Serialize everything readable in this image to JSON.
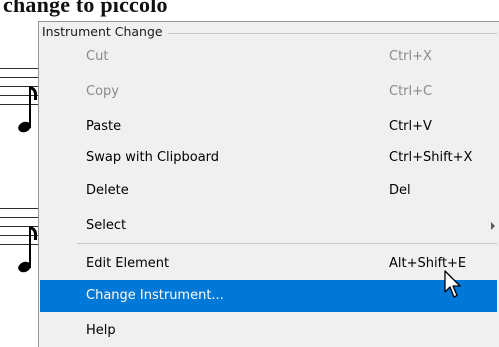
{
  "score": {
    "text": "change to piccolo"
  },
  "menu": {
    "title": "Instrument Change",
    "items": [
      {
        "label": "Cut",
        "shortcut": "Ctrl+X",
        "enabled": false
      },
      {
        "label": "Copy",
        "shortcut": "Ctrl+C",
        "enabled": false
      },
      {
        "label": "Paste",
        "shortcut": "Ctrl+V",
        "enabled": true
      },
      {
        "label": "Swap with Clipboard",
        "shortcut": "Ctrl+Shift+X",
        "enabled": true
      },
      {
        "label": "Delete",
        "shortcut": "Del",
        "enabled": true
      },
      {
        "label": "Select",
        "shortcut": "",
        "enabled": true,
        "has_submenu": true
      },
      {
        "label": "Edit Element",
        "shortcut": "Alt+Shift+E",
        "enabled": true
      },
      {
        "label": "Change Instrument...",
        "shortcut": "",
        "enabled": true,
        "highlighted": true
      },
      {
        "label": "Help",
        "shortcut": "",
        "enabled": true
      }
    ]
  },
  "colors": {
    "menu_background": "#f0f0f0",
    "highlight": "#0078d7",
    "disabled_text": "#8a8a8a"
  },
  "icons": {
    "submenu": "chevron-right-icon",
    "cursor": "mouse-pointer-icon"
  }
}
